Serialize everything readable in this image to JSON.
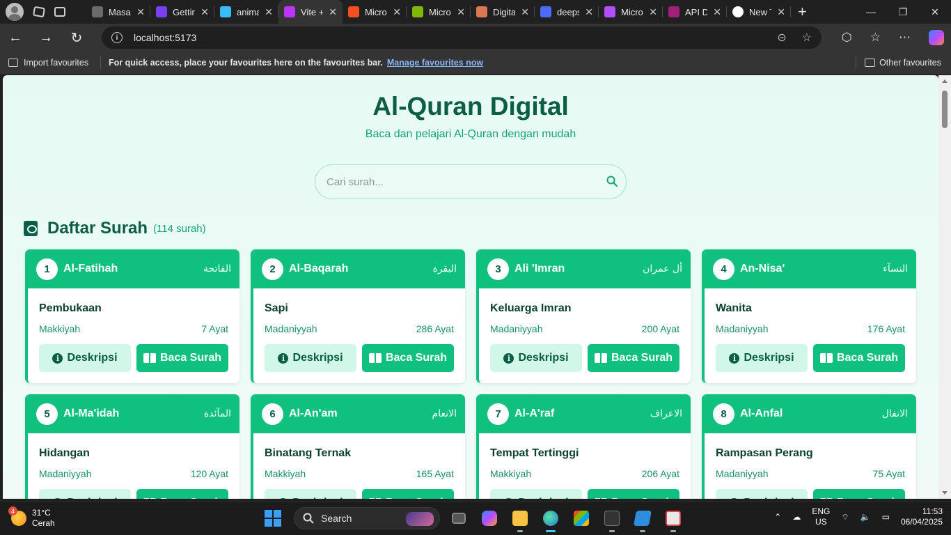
{
  "browser": {
    "tabs": [
      {
        "title": "Masal",
        "color": "#6b6b6b"
      },
      {
        "title": "Gettin",
        "color": "#7b3ff2"
      },
      {
        "title": "anima",
        "color": "#38bdf8"
      },
      {
        "title": "Vite +",
        "color": "#bd34fe",
        "active": true
      },
      {
        "title": "Micro",
        "color": "#f25022"
      },
      {
        "title": "Micro",
        "color": "#7fba00"
      },
      {
        "title": "Digita",
        "color": "#d97757"
      },
      {
        "title": "deeps",
        "color": "#4d6bfe"
      },
      {
        "title": "Micro",
        "color": "#b44cff"
      },
      {
        "title": "API D",
        "color": "#a0207a"
      },
      {
        "title": "New T",
        "color": "#ffffff"
      }
    ],
    "close_glyph": "✕",
    "new_tab_glyph": "+",
    "window_controls": [
      "—",
      "❐",
      "✕"
    ],
    "url": "localhost:5173",
    "favourites_bar": {
      "import_label": "Import favourites",
      "message": "For quick access, place your favourites here on the favourites bar.",
      "manage_link": "Manage favourites now",
      "other_label": "Other favourites"
    }
  },
  "app": {
    "title": "Al-Quran Digital",
    "subtitle": "Baca dan pelajari Al-Quran dengan mudah",
    "search_placeholder": "Cari surah...",
    "section_title": "Daftar Surah",
    "section_count": "(114 surah)",
    "desc_label": "Deskripsi",
    "read_label": "Baca Surah",
    "surahs": [
      {
        "number": "1",
        "name": "Al-Fatihah",
        "arabic": "الفاتحة",
        "meaning": "Pembukaan",
        "place": "Makkiyah",
        "ayat": "7 Ayat"
      },
      {
        "number": "2",
        "name": "Al-Baqarah",
        "arabic": "البقرة",
        "meaning": "Sapi",
        "place": "Madaniyyah",
        "ayat": "286 Ayat"
      },
      {
        "number": "3",
        "name": "Ali 'Imran",
        "arabic": "أل عمران",
        "meaning": "Keluarga Imran",
        "place": "Madaniyyah",
        "ayat": "200 Ayat"
      },
      {
        "number": "4",
        "name": "An-Nisa'",
        "arabic": "النسآء",
        "meaning": "Wanita",
        "place": "Madaniyyah",
        "ayat": "176 Ayat"
      },
      {
        "number": "5",
        "name": "Al-Ma'idah",
        "arabic": "المآئدة",
        "meaning": "Hidangan",
        "place": "Madaniyyah",
        "ayat": "120 Ayat"
      },
      {
        "number": "6",
        "name": "Al-An'am",
        "arabic": "الانعام",
        "meaning": "Binatang Ternak",
        "place": "Makkiyah",
        "ayat": "165 Ayat"
      },
      {
        "number": "7",
        "name": "Al-A'raf",
        "arabic": "الاعراف",
        "meaning": "Tempat Tertinggi",
        "place": "Makkiyah",
        "ayat": "206 Ayat"
      },
      {
        "number": "8",
        "name": "Al-Anfal",
        "arabic": "الانفال",
        "meaning": "Rampasan Perang",
        "place": "Madaniyyah",
        "ayat": "75 Ayat"
      }
    ]
  },
  "taskbar": {
    "weather_badge": "4",
    "temperature": "31°C",
    "condition": "Cerah",
    "search_label": "Search",
    "lang_line1": "ENG",
    "lang_line2": "US",
    "time": "11:53",
    "date": "06/04/2025"
  }
}
